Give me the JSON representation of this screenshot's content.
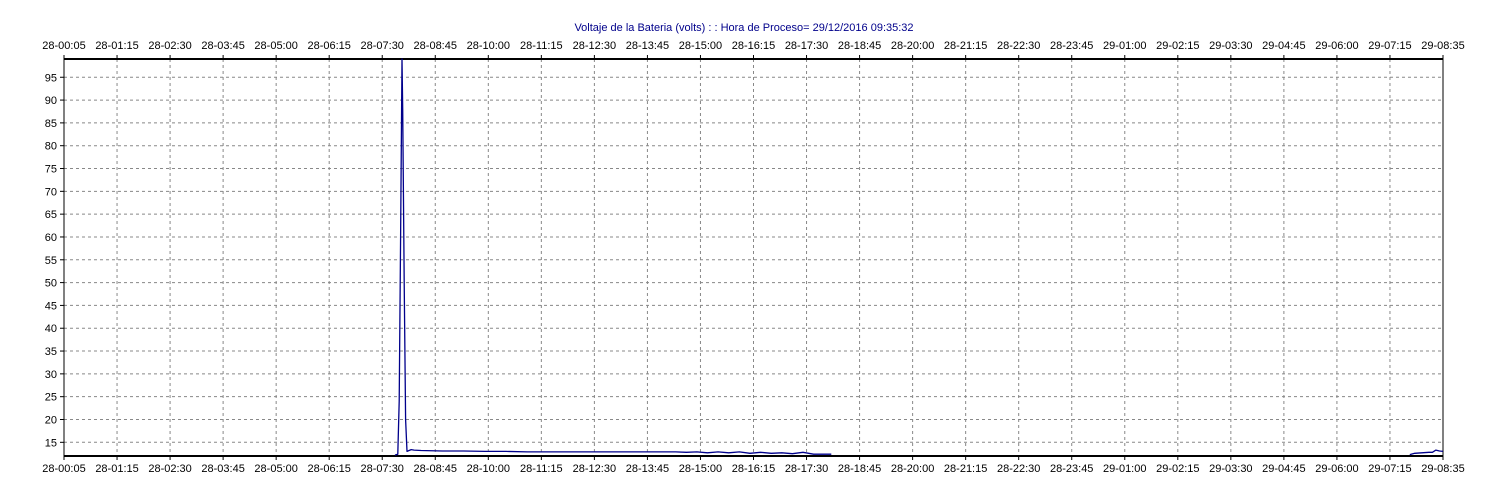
{
  "chart_data": {
    "type": "line",
    "title": "Voltaje de la Bateria (volts) : : Hora de Proceso= 29/12/2016 09:35:32",
    "xlabel": "",
    "ylabel": "",
    "x_tick_labels": [
      "28-00:05",
      "28-01:15",
      "28-02:30",
      "28-03:45",
      "28-05:00",
      "28-06:15",
      "28-07:30",
      "28-08:45",
      "28-10:00",
      "28-11:15",
      "28-12:30",
      "28-13:45",
      "28-15:00",
      "28-16:15",
      "28-17:30",
      "28-18:45",
      "28-20:00",
      "28-21:15",
      "28-22:30",
      "28-23:45",
      "29-01:00",
      "29-02:15",
      "29-03:30",
      "29-04:45",
      "29-06:00",
      "29-07:15",
      "29-08:35"
    ],
    "xlim": [
      "28-00:05",
      "29-08:35"
    ],
    "y_ticks": [
      15,
      20,
      25,
      30,
      35,
      40,
      45,
      50,
      55,
      60,
      65,
      70,
      75,
      80,
      85,
      90,
      95
    ],
    "ylim": [
      12,
      99
    ],
    "grid": true,
    "line_color": "#00008b",
    "title_color": "#00008b",
    "series": [
      {
        "x": [
          "28-07:53",
          "28-07:55",
          "28-07:57",
          "28-07:59",
          "28-08:01",
          "28-08:03",
          "28-08:04",
          "28-08:06",
          "28-08:08",
          "28-08:10",
          "28-08:13",
          "28-08:16",
          "28-08:20",
          "28-08:30",
          "28-09:00",
          "28-09:30",
          "28-10:00",
          "28-10:30",
          "28-11:00",
          "28-12:00",
          "28-13:00",
          "28-14:00",
          "28-14:30",
          "28-14:45",
          "28-15:00",
          "28-15:15",
          "28-15:30",
          "28-15:45",
          "28-16:00",
          "28-16:15",
          "28-16:30",
          "28-16:45",
          "28-17:00",
          "28-17:15",
          "28-17:30",
          "28-17:45",
          "28-18:00",
          "28-18:10"
        ],
        "y": [
          12.2,
          12.3,
          12.4,
          24,
          60,
          99,
          88,
          50,
          20,
          13,
          13.2,
          13.4,
          13.3,
          13.2,
          13.1,
          13.1,
          13.0,
          13.0,
          12.9,
          12.9,
          12.9,
          12.9,
          12.9,
          12.8,
          12.9,
          12.7,
          12.9,
          12.7,
          12.9,
          12.6,
          12.8,
          12.6,
          12.7,
          12.5,
          12.8,
          12.4,
          12.4,
          12.4
        ]
      },
      {
        "x": [
          "29-07:48",
          "29-07:55",
          "29-08:05",
          "29-08:15",
          "29-08:20",
          "29-08:25",
          "29-08:30",
          "29-08:35"
        ],
        "y": [
          12.3,
          12.6,
          12.7,
          12.8,
          12.8,
          13.3,
          13.1,
          13.0
        ]
      }
    ]
  }
}
